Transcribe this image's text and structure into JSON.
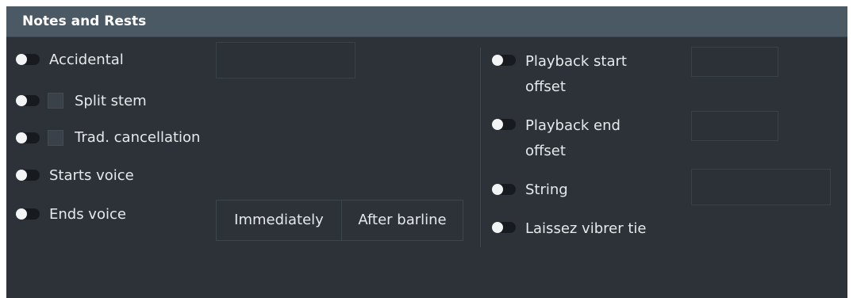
{
  "panel": {
    "title": "Notes and Rests"
  },
  "left": {
    "accidental": "Accidental",
    "split_stem": "Split stem",
    "trad_cancellation": "Trad. cancellation",
    "starts_voice": "Starts voice",
    "ends_voice": "Ends voice",
    "ends_voice_options": [
      "Immediately",
      "After barline"
    ]
  },
  "right": {
    "playback_start_line1": "Playback start",
    "playback_start_line2": "offset",
    "playback_end_line1": "Playback end",
    "playback_end_line2": "offset",
    "string": "String",
    "laissez_vibrer": "Laissez vibrer tie"
  },
  "colors": {
    "panel_bg": "#2c3238",
    "header_bg": "#4b5965",
    "toggle_track": "#171b1f",
    "toggle_knob": "#f3f4f5"
  }
}
